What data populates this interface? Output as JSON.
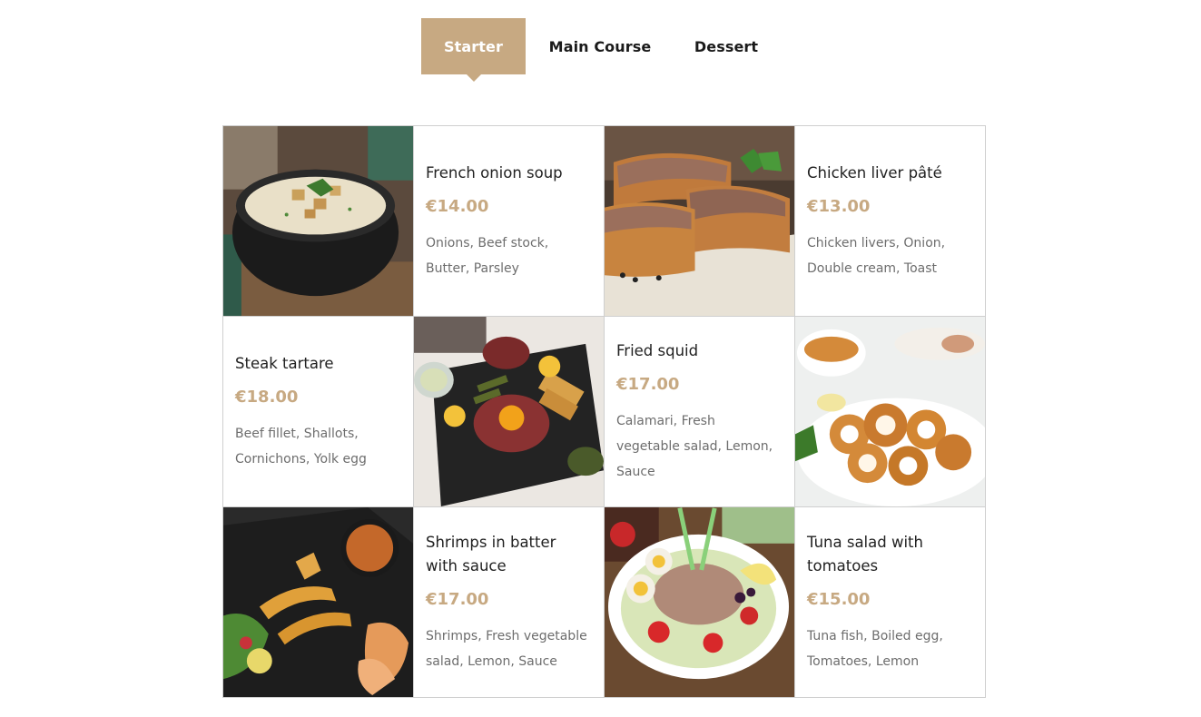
{
  "tabs": [
    {
      "label": "Starter",
      "active": true
    },
    {
      "label": "Main Course",
      "active": false
    },
    {
      "label": "Dessert",
      "active": false
    }
  ],
  "colors": {
    "accent": "#c7a982",
    "border": "#cfcfcf",
    "text": "#222222",
    "muted": "#6d6d6d"
  },
  "dishes": [
    {
      "name": "French onion soup",
      "price": "€14.00",
      "ingredients": "Onions, Beef stock, Butter, Parsley",
      "image": "soup-bowl-image"
    },
    {
      "name": "Chicken liver pâté",
      "price": "€13.00",
      "ingredients": "Chicken livers, Onion, Double cream, Toast",
      "image": "pate-toast-image"
    },
    {
      "name": "Steak tartare",
      "price": "€18.00",
      "ingredients": "Beef fillet, Shallots, Cornichons, Yolk egg",
      "image": "steak-tartare-image"
    },
    {
      "name": "Fried squid",
      "price": "€17.00",
      "ingredients": "Calamari, Fresh vegetable salad, Lemon, Sauce",
      "image": "fried-squid-image"
    },
    {
      "name": "Shrimps in batter with sauce",
      "price": "€17.00",
      "ingredients": "Shrimps, Fresh vegetable salad, Lemon, Sauce",
      "image": "shrimps-batter-image"
    },
    {
      "name": "Tuna salad with tomatoes",
      "price": "€15.00",
      "ingredients": "Tuna fish, Boiled egg, Tomatoes, Lemon",
      "image": "tuna-salad-image"
    }
  ]
}
